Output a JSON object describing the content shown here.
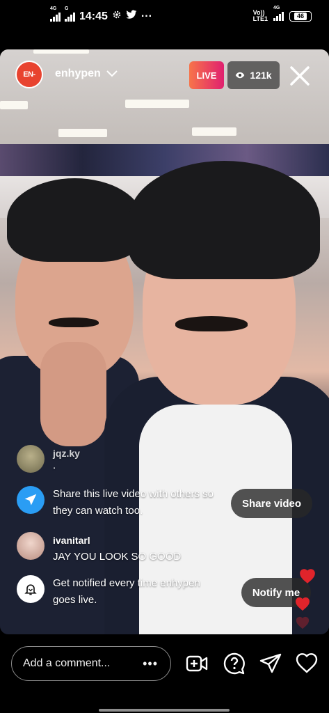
{
  "status_bar": {
    "network_left": "4G",
    "network_left2": "G",
    "time": "14:45",
    "more": "···",
    "volte": "Vo))",
    "lte": "LTE1",
    "network_right": "4G",
    "battery": "46"
  },
  "header": {
    "avatar_text": "EN-",
    "username": "enhypen",
    "live_label": "LIVE",
    "viewers": "121k"
  },
  "comments": [
    {
      "user": "jqz.ky",
      "text": "."
    },
    {
      "text": "Share this live video with others so they can watch too.",
      "button": "Share video"
    },
    {
      "user": "ivanitarl",
      "text": "JAY YOU LOOK SO GOOD"
    },
    {
      "text": "Get notified every time enhypen goes live.",
      "button": "Notify me"
    }
  ],
  "bottom_bar": {
    "comment_placeholder": "Add a comment...",
    "more": "•••"
  },
  "colors": {
    "live_gradient_start": "#f7744a",
    "live_gradient_end": "#e0206f",
    "share_icon_bg": "#2a9df4",
    "heart": "#e0242b"
  }
}
